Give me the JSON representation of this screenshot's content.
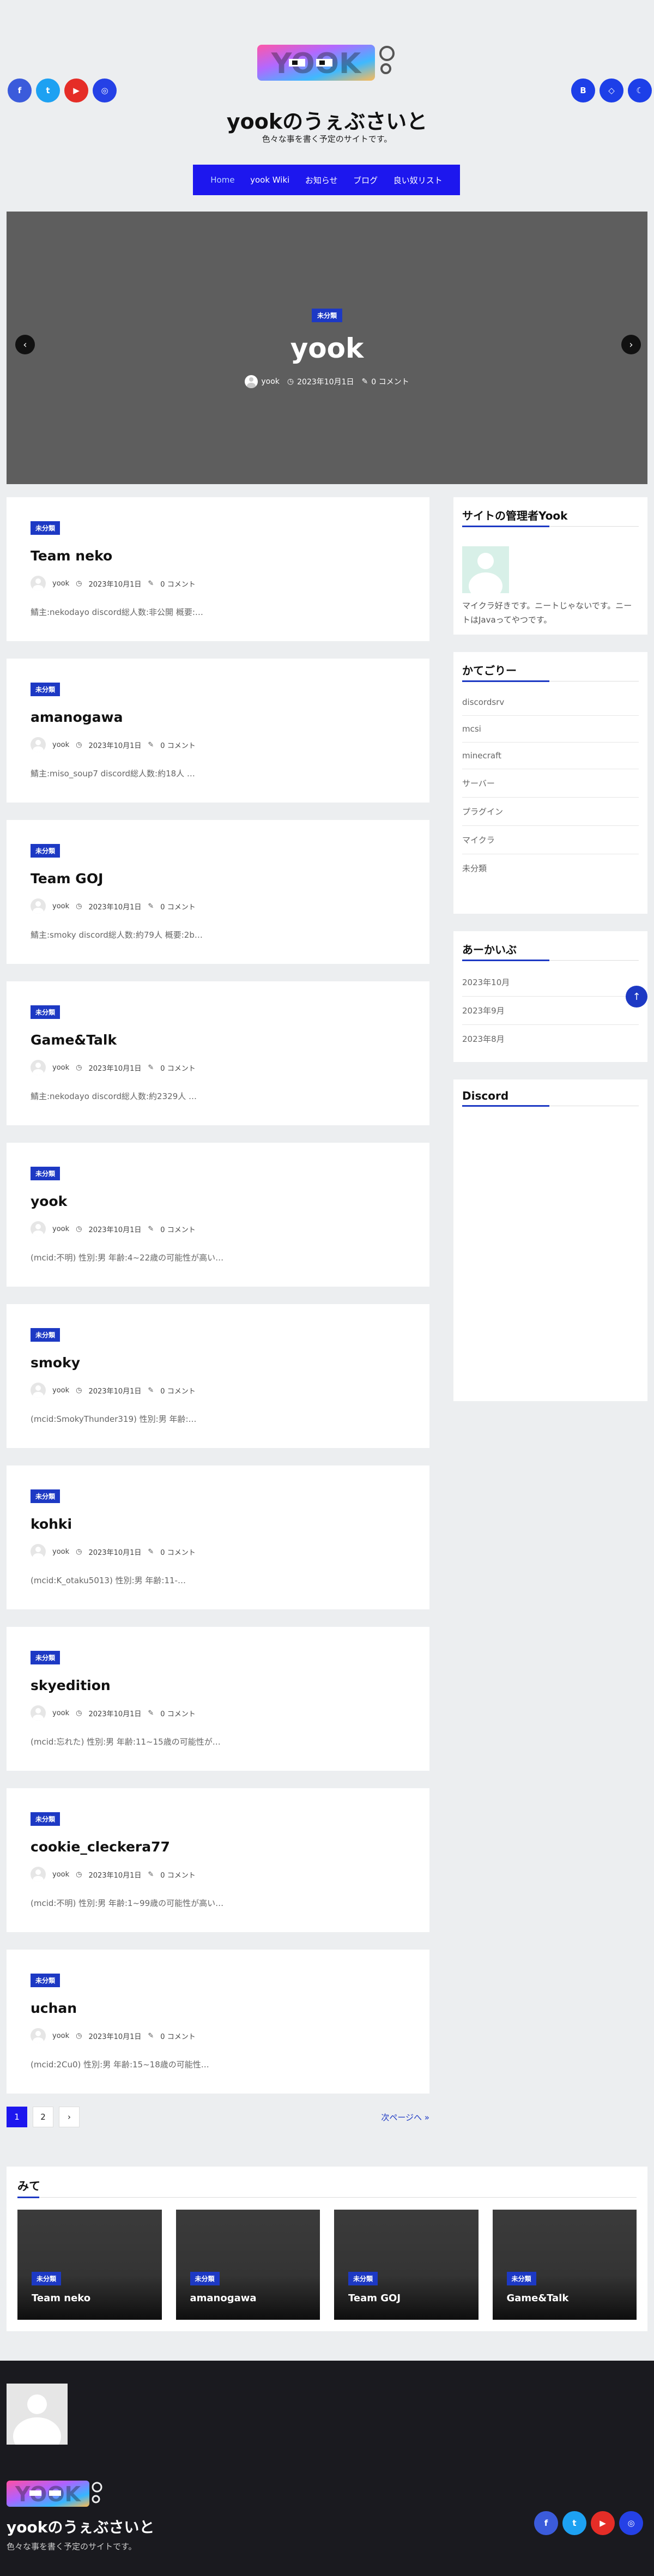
{
  "site": {
    "title": "yookのうぇぶさいと",
    "tagline": "色々な事を書く予定のサイトです。",
    "logo_text": "YOOK"
  },
  "social": {
    "left": [
      {
        "name": "facebook-icon",
        "glyph": "f"
      },
      {
        "name": "twitter-icon",
        "glyph": "t"
      },
      {
        "name": "youtube-icon",
        "glyph": "▶"
      },
      {
        "name": "instagram-icon",
        "glyph": "◎"
      }
    ],
    "right": [
      {
        "name": "blogger-icon",
        "glyph": "B"
      },
      {
        "name": "link-icon",
        "glyph": "◇"
      },
      {
        "name": "theme-toggle-icon",
        "glyph": "☾"
      }
    ]
  },
  "nav": {
    "items": [
      "Home",
      "yook Wiki",
      "お知らせ",
      "ブログ",
      "良い奴リスト"
    ]
  },
  "hero": {
    "badge": "未分類",
    "title": "yook",
    "author": "yook",
    "date": "2023年10月1日",
    "comments": "0 コメント"
  },
  "posts": [
    {
      "badge": "未分類",
      "title": "Team neko",
      "author": "yook",
      "date": "2023年10月1日",
      "comments": "0 コメント",
      "excerpt": "鯖主:nekodayo discord総人数:非公開 概要:…"
    },
    {
      "badge": "未分類",
      "title": "amanogawa",
      "author": "yook",
      "date": "2023年10月1日",
      "comments": "0 コメント",
      "excerpt": "鯖主:miso_soup7 discord総人数:約18人 …"
    },
    {
      "badge": "未分類",
      "title": "Team GOJ",
      "author": "yook",
      "date": "2023年10月1日",
      "comments": "0 コメント",
      "excerpt": "鯖主:smoky discord総人数:約79人 概要:2b…"
    },
    {
      "badge": "未分類",
      "title": "Game&Talk",
      "author": "yook",
      "date": "2023年10月1日",
      "comments": "0 コメント",
      "excerpt": "鯖主:nekodayo discord総人数:約2329人 …"
    },
    {
      "badge": "未分類",
      "title": "yook",
      "author": "yook",
      "date": "2023年10月1日",
      "comments": "0 コメント",
      "excerpt": "(mcid:不明) 性別:男 年齢:4~22歳の可能性が高い…"
    },
    {
      "badge": "未分類",
      "title": "smoky",
      "author": "yook",
      "date": "2023年10月1日",
      "comments": "0 コメント",
      "excerpt": "(mcid:SmokyThunder319) 性別:男 年齢:…"
    },
    {
      "badge": "未分類",
      "title": "kohki",
      "author": "yook",
      "date": "2023年10月1日",
      "comments": "0 コメント",
      "excerpt": "(mcid:K_otaku5013) 性別:男 年齢:11-…"
    },
    {
      "badge": "未分類",
      "title": "skyedition",
      "author": "yook",
      "date": "2023年10月1日",
      "comments": "0 コメント",
      "excerpt": "(mcid:忘れた) 性別:男 年齢:11~15歳の可能性が…"
    },
    {
      "badge": "未分類",
      "title": "cookie_cleckera77",
      "author": "yook",
      "date": "2023年10月1日",
      "comments": "0 コメント",
      "excerpt": "(mcid:不明) 性別:男 年齢:1~99歳の可能性が高い…"
    },
    {
      "badge": "未分類",
      "title": "uchan",
      "author": "yook",
      "date": "2023年10月1日",
      "comments": "0 コメント",
      "excerpt": "(mcid:2Cu0) 性別:男 年齢:15~18歳の可能性…"
    }
  ],
  "pagination": {
    "pages": [
      "1",
      "2",
      "›"
    ],
    "next": "次ページへ »"
  },
  "sidebar": {
    "admin": {
      "title": "サイトの管理者Yook",
      "text": "マイクラ好きです。ニートじゃないです。ニートはJavaってやつです。"
    },
    "categories": {
      "title": "かてごりー",
      "items": [
        "discordsrv",
        "mcsi",
        "minecraft",
        "サーバー",
        "プラグイン",
        "マイクラ",
        "未分類"
      ]
    },
    "archives": {
      "title": "あーかいぶ",
      "items": [
        "2023年10月",
        "2023年9月",
        "2023年8月"
      ]
    },
    "discord": {
      "title": "Discord"
    }
  },
  "mite": {
    "title": "みて",
    "cards": [
      {
        "badge": "未分類",
        "title": "Team neko"
      },
      {
        "badge": "未分類",
        "title": "amanogawa"
      },
      {
        "badge": "未分類",
        "title": "Team GOJ"
      },
      {
        "badge": "未分類",
        "title": "Game&Talk"
      }
    ]
  },
  "footer": {
    "title": "yookのうぇぶさいと",
    "tagline": "色々な事を書く予定のサイトです。"
  },
  "colors": {
    "accent": "#1d17ee",
    "badge": "#1d39c4",
    "footer_bg": "#1a1a1f",
    "page_bg": "#eceef0"
  }
}
